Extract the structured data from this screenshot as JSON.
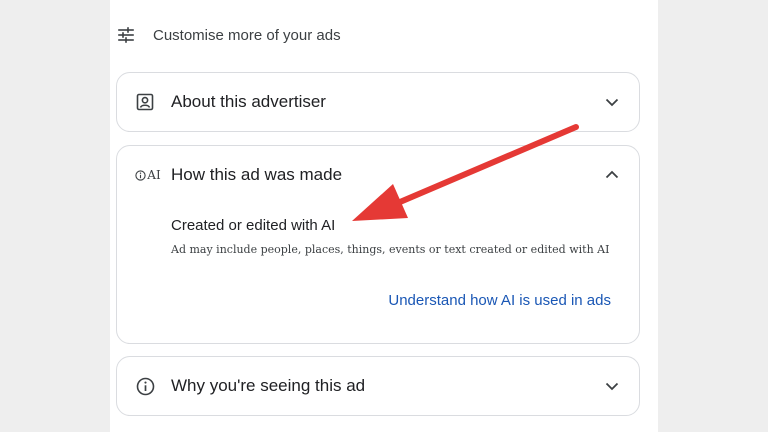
{
  "customise": {
    "label": "Customise more of your ads",
    "icon": "tune-sliders-icon"
  },
  "cards": {
    "advertiser": {
      "title": "About this advertiser",
      "icon": "person-badge-icon",
      "expanded": false
    },
    "how_made": {
      "title": "How this ad was made",
      "icon_text": "AI",
      "expanded": true,
      "subtitle": "Created or edited with AI",
      "description": "Ad may include people, places, things, events or text created or edited with AI",
      "link": "Understand how AI is used in ads"
    },
    "why_seeing": {
      "title": "Why you're seeing this ad",
      "icon": "info-icon",
      "expanded": false
    }
  },
  "colors": {
    "link": "#1a57b5",
    "arrow": "#e53935",
    "border": "#dadce0"
  }
}
